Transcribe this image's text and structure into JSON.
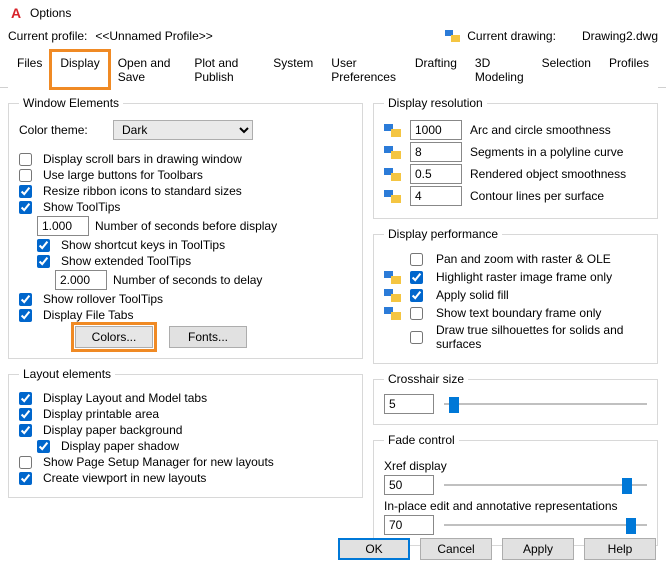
{
  "window": {
    "title": "Options"
  },
  "profile": {
    "label": "Current profile:",
    "value": "<<Unnamed Profile>>",
    "drawing_label": "Current drawing:",
    "drawing_value": "Drawing2.dwg"
  },
  "tabs": {
    "files": "Files",
    "display": "Display",
    "open_save": "Open and Save",
    "plot_publish": "Plot and Publish",
    "system": "System",
    "user_prefs": "User Preferences",
    "drafting": "Drafting",
    "modeling": "3D Modeling",
    "selection": "Selection",
    "profiles": "Profiles"
  },
  "window_elements": {
    "legend": "Window Elements",
    "color_theme_label": "Color theme:",
    "color_theme_value": "Dark",
    "scroll_bars": "Display scroll bars in drawing window",
    "large_buttons": "Use large buttons for Toolbars",
    "resize_ribbon": "Resize ribbon icons to standard sizes",
    "show_tooltips": "Show ToolTips",
    "tooltip_seconds_value": "1.000",
    "tooltip_seconds_label": "Number of seconds before display",
    "shortcut_keys": "Show shortcut keys in ToolTips",
    "extended_tooltips": "Show extended ToolTips",
    "extended_seconds_value": "2.000",
    "extended_seconds_label": "Number of seconds to delay",
    "rollover": "Show rollover ToolTips",
    "file_tabs": "Display File Tabs",
    "colors_btn": "Colors...",
    "fonts_btn": "Fonts..."
  },
  "layout_elements": {
    "legend": "Layout elements",
    "layout_model_tabs": "Display Layout and Model tabs",
    "printable_area": "Display printable area",
    "paper_background": "Display paper background",
    "paper_shadow": "Display paper shadow",
    "page_setup_mgr": "Show Page Setup Manager for new layouts",
    "create_viewport": "Create viewport in new layouts"
  },
  "display_resolution": {
    "legend": "Display resolution",
    "arc_value": "1000",
    "arc_label": "Arc and circle smoothness",
    "seg_value": "8",
    "seg_label": "Segments in a polyline curve",
    "render_value": "0.5",
    "render_label": "Rendered object smoothness",
    "contour_value": "4",
    "contour_label": "Contour lines per surface"
  },
  "display_performance": {
    "legend": "Display performance",
    "pan_zoom": "Pan and zoom with raster & OLE",
    "highlight_raster": "Highlight raster image frame only",
    "solid_fill": "Apply solid fill",
    "text_boundary": "Show text boundary frame only",
    "true_silhouettes": "Draw true silhouettes for solids and surfaces"
  },
  "crosshair": {
    "legend": "Crosshair size",
    "value": "5",
    "percent": 5
  },
  "fade": {
    "legend": "Fade control",
    "xref_label": "Xref display",
    "xref_value": "50",
    "xref_percent": 90,
    "inplace_label": "In-place edit and annotative representations",
    "inplace_value": "70",
    "inplace_percent": 92
  },
  "footer": {
    "ok": "OK",
    "cancel": "Cancel",
    "apply": "Apply",
    "help": "Help"
  }
}
